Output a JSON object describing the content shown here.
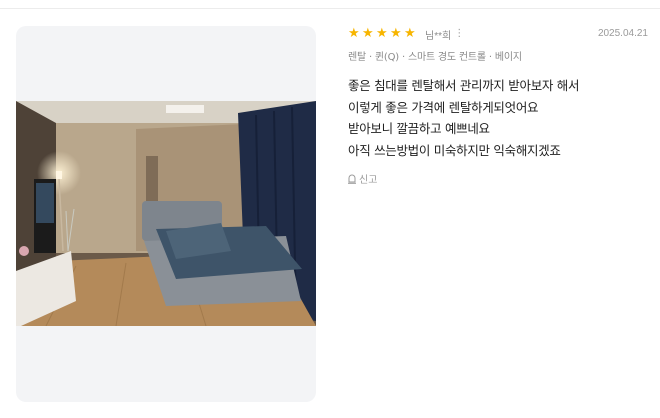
{
  "review": {
    "rating": 5,
    "rating_max": 5,
    "author": "님**희",
    "more_icon": "more-vertical-icon",
    "date": "2025.04.21",
    "option": "렌탈 · 퀸(Q) · 스마트 경도 컨트롤 · 베이지",
    "body_lines": [
      "좋은 침대를 렌탈해서 관리까지 받아보자 해서",
      "이렇게 좋은 가격에 렌탈하게되엇어요",
      "받아보니 깔끔하고 예쁘네요",
      "아직 쓰는방법이 미숙하지만 익숙해지겠죠"
    ],
    "report_label": "신고",
    "report_icon": "report-siren-icon"
  },
  "colors": {
    "star": "#f7b500",
    "card_bg": "#f3f4f6",
    "muted_text": "#8a8a8a"
  }
}
